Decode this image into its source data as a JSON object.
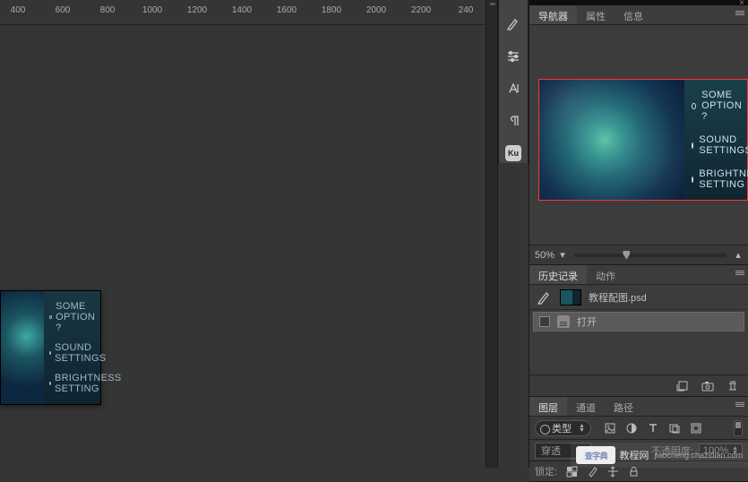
{
  "ruler": {
    "marks": [
      "400",
      "600",
      "800",
      "1000",
      "1200",
      "1400",
      "1600",
      "1800",
      "2000",
      "2200",
      "240"
    ]
  },
  "tool_strip": {
    "ku_label": "Ku"
  },
  "navigator_panel": {
    "tabs": {
      "navigator": "导航器",
      "properties": "属性",
      "info": "信息"
    },
    "preview_menu": {
      "item1": "SOME OPTION ?",
      "item2": "SOUND SETTINGS",
      "item3": "BRIGHTNESS SETTING"
    },
    "zoom_value": "50%"
  },
  "history_panel": {
    "tabs": {
      "history": "历史记录",
      "actions": "动作"
    },
    "document_name": "教程配图.psd",
    "steps": {
      "open": "打开"
    }
  },
  "layers_panel": {
    "tabs": {
      "layers": "图层",
      "channels": "通道",
      "paths": "路径"
    },
    "kind_label": "类型",
    "blend_mode": "穿透",
    "opacity_label": "不透明度:",
    "opacity_value": "100%",
    "lock_label": "锁定:"
  },
  "canvas_preview": {
    "item1": "SOME OPTION ?",
    "item2": "SOUND SETTINGS",
    "item3": "BRIGHTNESS SETTING"
  },
  "watermark": {
    "logo_text": "查字典",
    "main": "教程网",
    "sub": "jiaocheng.chazidian.com"
  }
}
